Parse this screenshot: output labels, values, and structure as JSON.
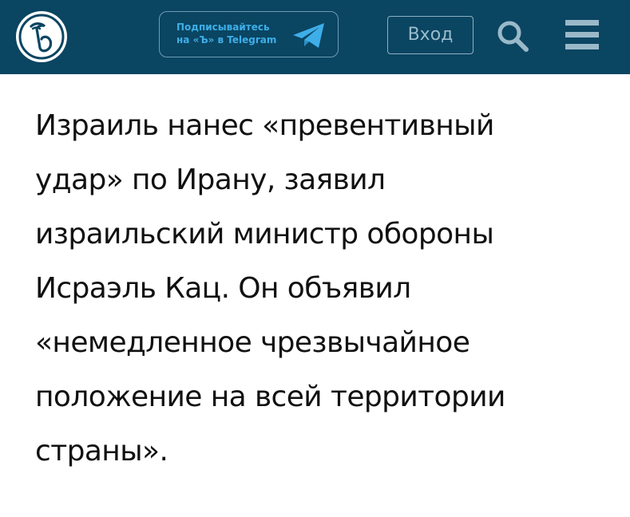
{
  "header": {
    "logo_text": "Ъ",
    "telegram_cta": {
      "line1": "Подписывайтесь",
      "line2": "на «Ъ» в Telegram"
    },
    "login_label": "Вход",
    "icons": {
      "telegram": "telegram-plane-icon",
      "search": "search-icon",
      "menu": "hamburger-menu-icon"
    }
  },
  "article": {
    "text": "Израиль нанес «превентивный удар» по Ирану, заявил израильский министр обороны Исраэль Кац. Он объявил «немедленное чрезвычайное положение на всей территории страны»."
  },
  "colors": {
    "header_bg": "#0a4562",
    "accent": "#3eaee8",
    "text": "#111111"
  }
}
